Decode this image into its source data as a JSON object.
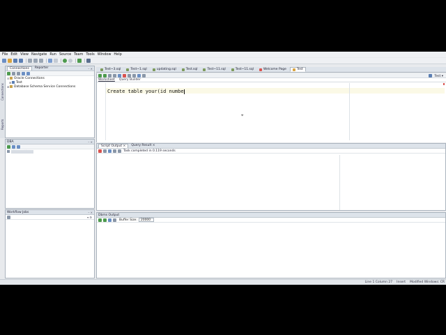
{
  "menu": [
    "File",
    "Edit",
    "View",
    "Navigate",
    "Run",
    "Source",
    "Team",
    "Tools",
    "Window",
    "Help"
  ],
  "left_strip": {
    "tab1": "Connections",
    "tab2": "Reports"
  },
  "connections_panel": {
    "tabs": [
      "Connections",
      "Reporter"
    ],
    "items": [
      {
        "label": "Oracle Connections",
        "toggle": "⊟"
      },
      {
        "label": "Test",
        "toggle": "⊞"
      },
      {
        "label": "Database Schema Service Connections",
        "toggle": "⊞"
      }
    ]
  },
  "dba_panel": {
    "title": "DBA",
    "item": "Connections"
  },
  "workflow_panel": {
    "title": "Workflow Jobs"
  },
  "editor_tabs": [
    "Test~3.sql",
    "Test~1.sql",
    "updating.sql",
    "Test.sql",
    "Test~11.sql",
    "Test~11.sql",
    "Welcome Page",
    "Test"
  ],
  "editor": {
    "subtabs": [
      "Worksheet",
      "Query Builder"
    ],
    "code": "Create table your(id numbe",
    "connection": "Test"
  },
  "results": {
    "tabs": [
      "Script Output",
      "Query Result"
    ],
    "status": "Task completed in 0.119 seconds"
  },
  "dbms": {
    "title": "Dbms Output",
    "buffer_label": "Buffer Size:",
    "buffer_value": "20000"
  },
  "statusbar": {
    "position": "Line 1 Column 27",
    "mode": "Insert",
    "modified": "Modified Windows: CR"
  },
  "colors": {
    "accent": "#d9534f",
    "tab_active": "#ffffff",
    "panel_head": "#dde3ea"
  }
}
